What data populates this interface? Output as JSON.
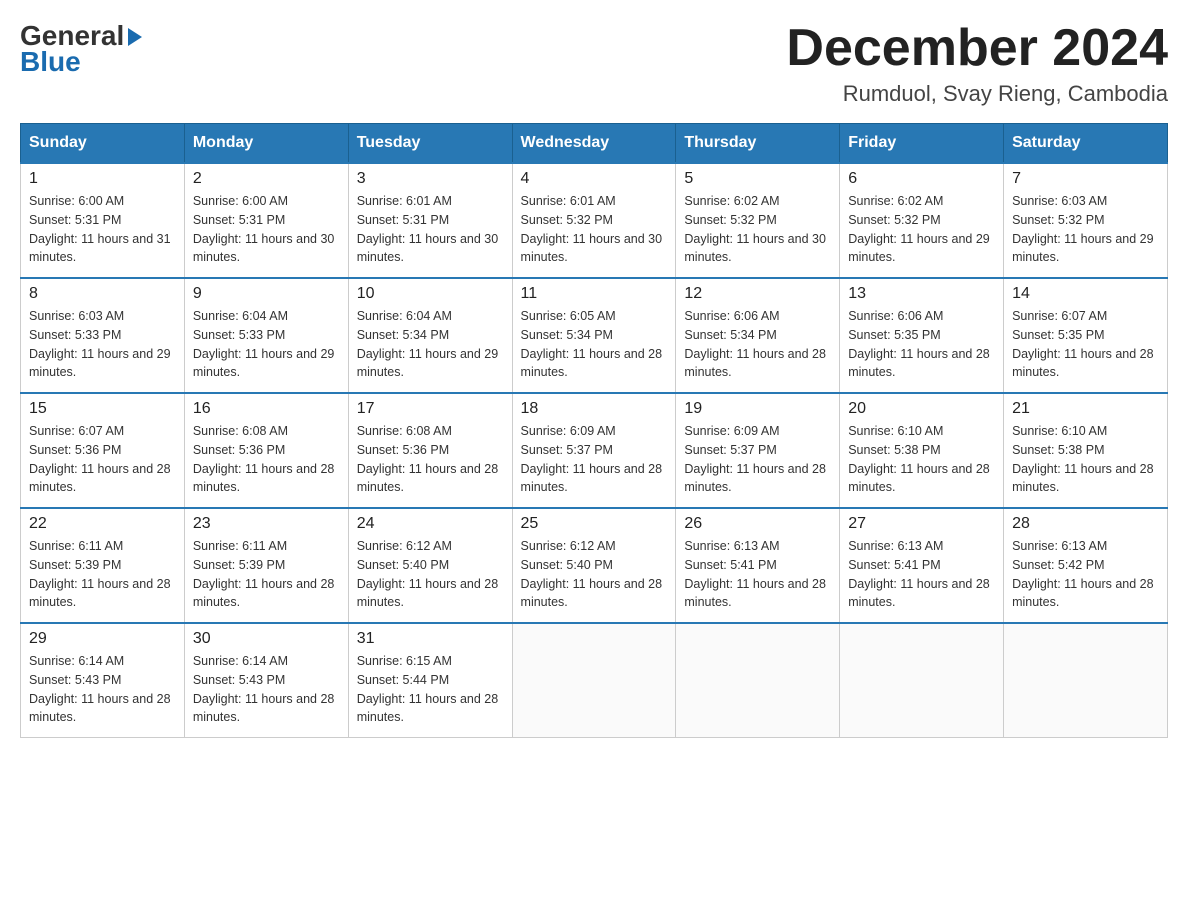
{
  "header": {
    "logo": {
      "general": "General",
      "blue": "Blue"
    },
    "title": "December 2024",
    "location": "Rumduol, Svay Rieng, Cambodia"
  },
  "days_of_week": [
    "Sunday",
    "Monday",
    "Tuesday",
    "Wednesday",
    "Thursday",
    "Friday",
    "Saturday"
  ],
  "weeks": [
    [
      {
        "day": "1",
        "sunrise": "6:00 AM",
        "sunset": "5:31 PM",
        "daylight": "11 hours and 31 minutes."
      },
      {
        "day": "2",
        "sunrise": "6:00 AM",
        "sunset": "5:31 PM",
        "daylight": "11 hours and 30 minutes."
      },
      {
        "day": "3",
        "sunrise": "6:01 AM",
        "sunset": "5:31 PM",
        "daylight": "11 hours and 30 minutes."
      },
      {
        "day": "4",
        "sunrise": "6:01 AM",
        "sunset": "5:32 PM",
        "daylight": "11 hours and 30 minutes."
      },
      {
        "day": "5",
        "sunrise": "6:02 AM",
        "sunset": "5:32 PM",
        "daylight": "11 hours and 30 minutes."
      },
      {
        "day": "6",
        "sunrise": "6:02 AM",
        "sunset": "5:32 PM",
        "daylight": "11 hours and 29 minutes."
      },
      {
        "day": "7",
        "sunrise": "6:03 AM",
        "sunset": "5:32 PM",
        "daylight": "11 hours and 29 minutes."
      }
    ],
    [
      {
        "day": "8",
        "sunrise": "6:03 AM",
        "sunset": "5:33 PM",
        "daylight": "11 hours and 29 minutes."
      },
      {
        "day": "9",
        "sunrise": "6:04 AM",
        "sunset": "5:33 PM",
        "daylight": "11 hours and 29 minutes."
      },
      {
        "day": "10",
        "sunrise": "6:04 AM",
        "sunset": "5:34 PM",
        "daylight": "11 hours and 29 minutes."
      },
      {
        "day": "11",
        "sunrise": "6:05 AM",
        "sunset": "5:34 PM",
        "daylight": "11 hours and 28 minutes."
      },
      {
        "day": "12",
        "sunrise": "6:06 AM",
        "sunset": "5:34 PM",
        "daylight": "11 hours and 28 minutes."
      },
      {
        "day": "13",
        "sunrise": "6:06 AM",
        "sunset": "5:35 PM",
        "daylight": "11 hours and 28 minutes."
      },
      {
        "day": "14",
        "sunrise": "6:07 AM",
        "sunset": "5:35 PM",
        "daylight": "11 hours and 28 minutes."
      }
    ],
    [
      {
        "day": "15",
        "sunrise": "6:07 AM",
        "sunset": "5:36 PM",
        "daylight": "11 hours and 28 minutes."
      },
      {
        "day": "16",
        "sunrise": "6:08 AM",
        "sunset": "5:36 PM",
        "daylight": "11 hours and 28 minutes."
      },
      {
        "day": "17",
        "sunrise": "6:08 AM",
        "sunset": "5:36 PM",
        "daylight": "11 hours and 28 minutes."
      },
      {
        "day": "18",
        "sunrise": "6:09 AM",
        "sunset": "5:37 PM",
        "daylight": "11 hours and 28 minutes."
      },
      {
        "day": "19",
        "sunrise": "6:09 AM",
        "sunset": "5:37 PM",
        "daylight": "11 hours and 28 minutes."
      },
      {
        "day": "20",
        "sunrise": "6:10 AM",
        "sunset": "5:38 PM",
        "daylight": "11 hours and 28 minutes."
      },
      {
        "day": "21",
        "sunrise": "6:10 AM",
        "sunset": "5:38 PM",
        "daylight": "11 hours and 28 minutes."
      }
    ],
    [
      {
        "day": "22",
        "sunrise": "6:11 AM",
        "sunset": "5:39 PM",
        "daylight": "11 hours and 28 minutes."
      },
      {
        "day": "23",
        "sunrise": "6:11 AM",
        "sunset": "5:39 PM",
        "daylight": "11 hours and 28 minutes."
      },
      {
        "day": "24",
        "sunrise": "6:12 AM",
        "sunset": "5:40 PM",
        "daylight": "11 hours and 28 minutes."
      },
      {
        "day": "25",
        "sunrise": "6:12 AM",
        "sunset": "5:40 PM",
        "daylight": "11 hours and 28 minutes."
      },
      {
        "day": "26",
        "sunrise": "6:13 AM",
        "sunset": "5:41 PM",
        "daylight": "11 hours and 28 minutes."
      },
      {
        "day": "27",
        "sunrise": "6:13 AM",
        "sunset": "5:41 PM",
        "daylight": "11 hours and 28 minutes."
      },
      {
        "day": "28",
        "sunrise": "6:13 AM",
        "sunset": "5:42 PM",
        "daylight": "11 hours and 28 minutes."
      }
    ],
    [
      {
        "day": "29",
        "sunrise": "6:14 AM",
        "sunset": "5:43 PM",
        "daylight": "11 hours and 28 minutes."
      },
      {
        "day": "30",
        "sunrise": "6:14 AM",
        "sunset": "5:43 PM",
        "daylight": "11 hours and 28 minutes."
      },
      {
        "day": "31",
        "sunrise": "6:15 AM",
        "sunset": "5:44 PM",
        "daylight": "11 hours and 28 minutes."
      },
      null,
      null,
      null,
      null
    ]
  ],
  "labels": {
    "sunrise": "Sunrise:",
    "sunset": "Sunset:",
    "daylight": "Daylight:"
  }
}
